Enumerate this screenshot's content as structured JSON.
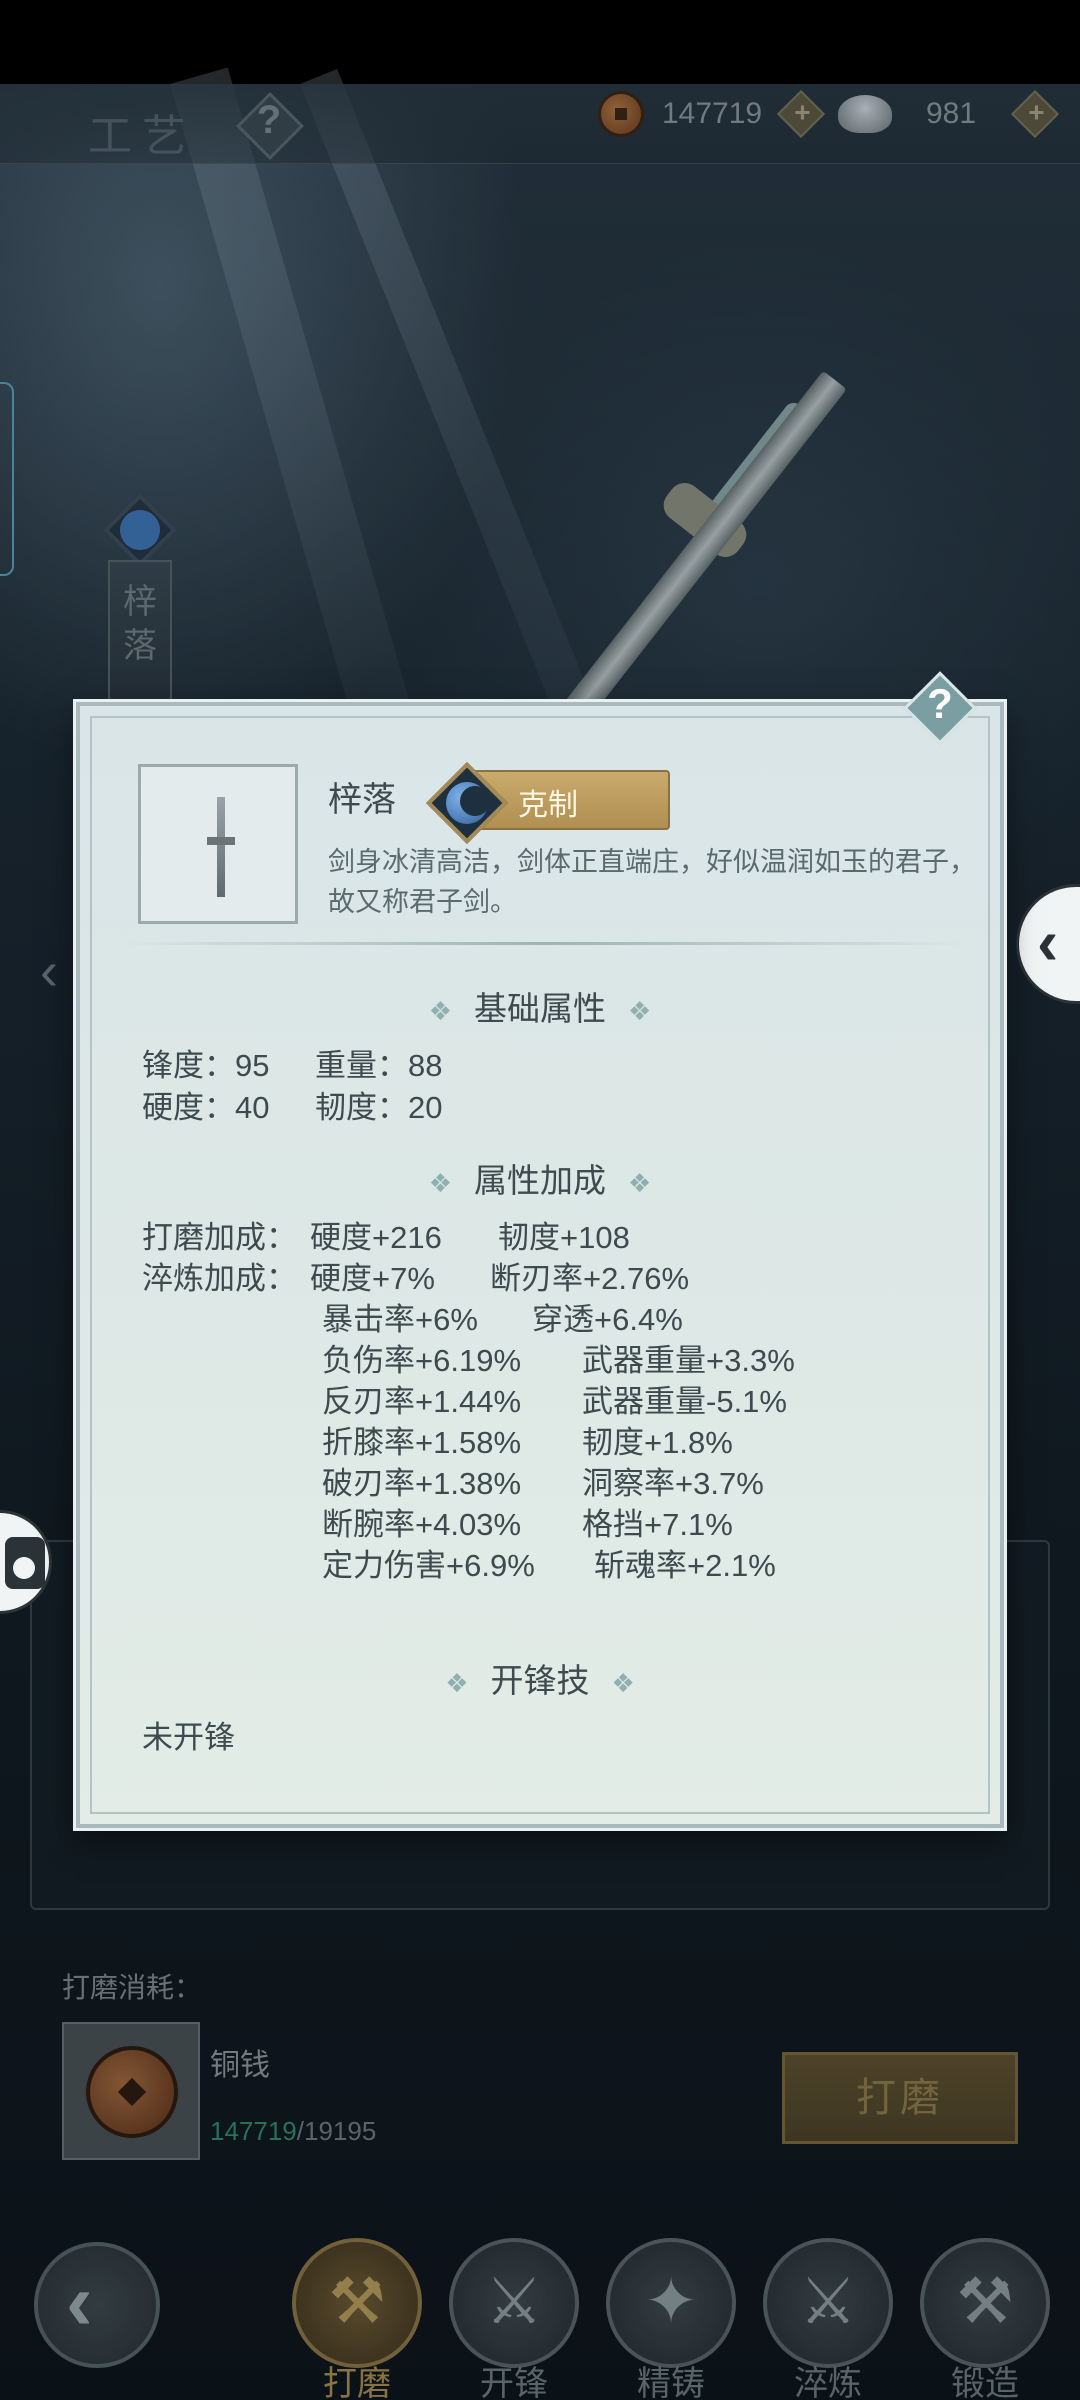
{
  "header": {
    "title": "工艺",
    "help_glyph": "?",
    "copper_value": "147719",
    "silver_value": "981"
  },
  "side_tab": {
    "label": "梓落"
  },
  "modal": {
    "help_glyph": "?",
    "item_name": "梓落",
    "counter_label": "克制",
    "description": "剑身冰清高洁，剑体正直端庄，好似温润如玉的君子，故又称君子剑。",
    "base_section_title": "基础属性",
    "base_stats": [
      {
        "label": "锋度：",
        "value": "95"
      },
      {
        "label": "重量：",
        "value": "88"
      },
      {
        "label": "硬度：",
        "value": "40"
      },
      {
        "label": "韧度：",
        "value": "20"
      }
    ],
    "bonus_section_title": "属性加成",
    "grind_label": "打磨加成：",
    "grind_bonuses": [
      "硬度+216",
      "韧度+108"
    ],
    "temper_label": "淬炼加成：",
    "temper_bonuses": [
      [
        "硬度+7%",
        "断刃率+2.76%"
      ],
      [
        "暴击率+6%",
        "穿透+6.4%"
      ],
      [
        "负伤率+6.19%",
        "武器重量+3.3%"
      ],
      [
        "反刃率+1.44%",
        "武器重量-5.1%"
      ],
      [
        "折膝率+1.58%",
        "韧度+1.8%"
      ],
      [
        "破刃率+1.38%",
        "洞察率+3.7%"
      ],
      [
        "断腕率+4.03%",
        "格挡+7.1%"
      ],
      [
        "定力伤害+6.9%",
        "斩魂率+2.1%"
      ]
    ],
    "skill_section_title": "开锋技",
    "skill_value": "未开锋"
  },
  "cost": {
    "label": "打磨消耗：",
    "item_name": "铜钱",
    "have": "147719",
    "need": "/19195",
    "button_label": "打磨"
  },
  "bottom_nav": {
    "items": [
      {
        "label": "打磨",
        "icon": "grind-icon",
        "glyph": "⚒",
        "active": true
      },
      {
        "label": "开锋",
        "icon": "sharpen-icon",
        "glyph": "⚔",
        "active": false
      },
      {
        "label": "精铸",
        "icon": "cast-icon",
        "glyph": "✦",
        "active": false
      },
      {
        "label": "淬炼",
        "icon": "temper-icon",
        "glyph": "⚔",
        "active": false
      },
      {
        "label": "锻造",
        "icon": "forge-icon",
        "glyph": "⚒",
        "active": false
      }
    ]
  },
  "colors": {
    "modal_bg": "#dde8e6",
    "gold_badge": "#c9ab6c",
    "have_green": "#2e8c6c",
    "active_nav": "#a88c52"
  }
}
